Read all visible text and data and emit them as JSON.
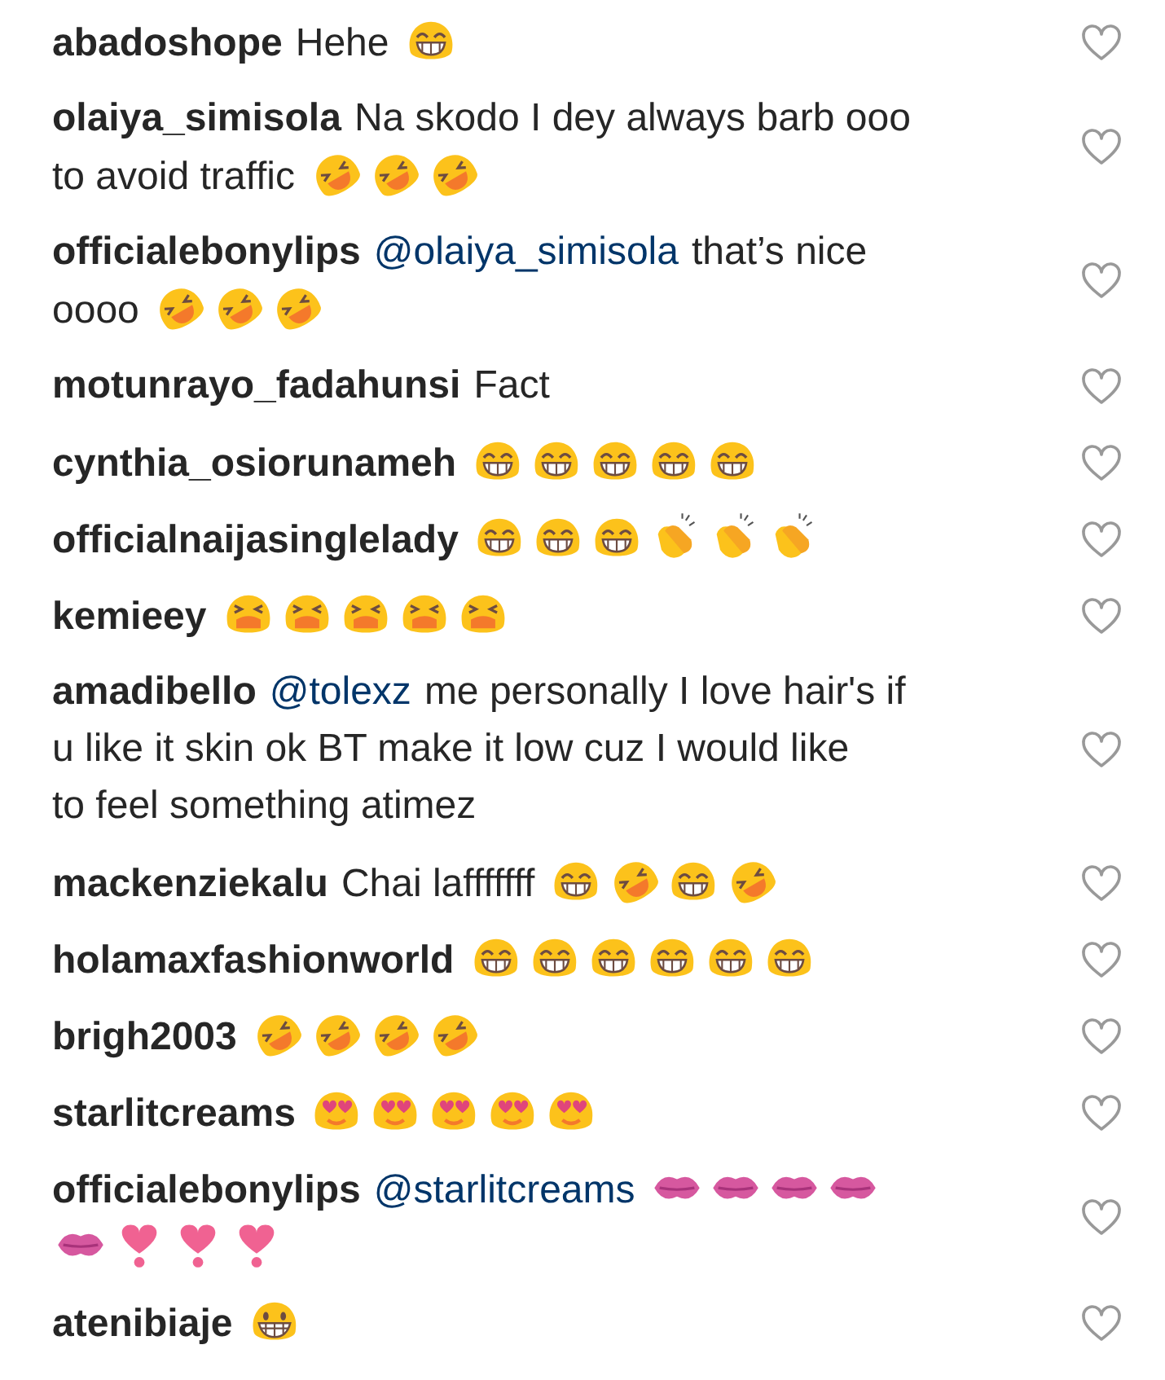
{
  "comments": [
    {
      "user": "abadoshope",
      "lines": [
        [
          {
            "kind": "text",
            "text": "Hehe"
          },
          {
            "kind": "laugh"
          }
        ]
      ]
    },
    {
      "user": "olaiya_simisola",
      "lines": [
        [
          {
            "kind": "text",
            "text": "Na skodo I dey always barb ooo"
          }
        ],
        [
          {
            "kind": "text",
            "text": "to avoid traffic"
          },
          {
            "kind": "rofl"
          },
          {
            "kind": "rofl"
          },
          {
            "kind": "rofl"
          }
        ]
      ]
    },
    {
      "user": "officialebonylips",
      "lines": [
        [
          {
            "kind": "mention",
            "text": "@olaiya_simisola"
          },
          {
            "kind": "text",
            "text": "that’s nice"
          }
        ],
        [
          {
            "kind": "text",
            "text": "oooo"
          },
          {
            "kind": "rofl"
          },
          {
            "kind": "rofl"
          },
          {
            "kind": "rofl"
          }
        ]
      ]
    },
    {
      "user": "motunrayo_fadahunsi",
      "lines": [
        [
          {
            "kind": "text",
            "text": "Fact"
          }
        ]
      ]
    },
    {
      "user": "cynthia_osiorunameh",
      "lines": [
        [
          {
            "kind": "laugh"
          },
          {
            "kind": "laugh"
          },
          {
            "kind": "laugh"
          },
          {
            "kind": "laugh"
          },
          {
            "kind": "laugh"
          }
        ]
      ]
    },
    {
      "user": "officialnaijasinglelady",
      "lines": [
        [
          {
            "kind": "laugh"
          },
          {
            "kind": "laugh"
          },
          {
            "kind": "laugh"
          },
          {
            "kind": "clap"
          },
          {
            "kind": "clap"
          },
          {
            "kind": "clap"
          }
        ]
      ]
    },
    {
      "user": "kemieey",
      "lines": [
        [
          {
            "kind": "sob"
          },
          {
            "kind": "sob"
          },
          {
            "kind": "sob"
          },
          {
            "kind": "sob"
          },
          {
            "kind": "sob"
          }
        ]
      ]
    },
    {
      "user": "amadibello",
      "lines": [
        [
          {
            "kind": "mention",
            "text": "@tolexz"
          },
          {
            "kind": "text",
            "text": "me personally I love hair's if"
          }
        ],
        [
          {
            "kind": "text",
            "text": "u like it skin ok BT make it low cuz I would like"
          }
        ],
        [
          {
            "kind": "text",
            "text": "to feel something atimez"
          }
        ]
      ]
    },
    {
      "user": "mackenziekalu",
      "lines": [
        [
          {
            "kind": "text",
            "text": "Chai lafffffff"
          },
          {
            "kind": "laugh"
          },
          {
            "kind": "rofl"
          },
          {
            "kind": "laugh"
          },
          {
            "kind": "rofl"
          }
        ]
      ]
    },
    {
      "user": "holamaxfashionworld",
      "lines": [
        [
          {
            "kind": "laugh"
          },
          {
            "kind": "laugh"
          },
          {
            "kind": "laugh"
          },
          {
            "kind": "laugh"
          },
          {
            "kind": "laugh"
          },
          {
            "kind": "laugh"
          }
        ]
      ]
    },
    {
      "user": "brigh2003",
      "lines": [
        [
          {
            "kind": "rofl"
          },
          {
            "kind": "rofl"
          },
          {
            "kind": "rofl"
          },
          {
            "kind": "rofl"
          }
        ]
      ]
    },
    {
      "user": "starlitcreams",
      "lines": [
        [
          {
            "kind": "heart_eyes"
          },
          {
            "kind": "heart_eyes"
          },
          {
            "kind": "heart_eyes"
          },
          {
            "kind": "heart_eyes"
          },
          {
            "kind": "heart_eyes"
          }
        ]
      ]
    },
    {
      "user": "officialebonylips",
      "lines": [
        [
          {
            "kind": "mention",
            "text": "@starlitcreams"
          },
          {
            "kind": "kiss"
          },
          {
            "kind": "kiss"
          },
          {
            "kind": "kiss"
          },
          {
            "kind": "kiss"
          }
        ],
        [
          {
            "kind": "kiss"
          },
          {
            "kind": "heart_exclamation"
          },
          {
            "kind": "heart_exclamation"
          },
          {
            "kind": "heart_exclamation"
          }
        ]
      ]
    },
    {
      "user": "atenibiaje",
      "lines": [
        [
          {
            "kind": "grin"
          }
        ]
      ]
    }
  ]
}
